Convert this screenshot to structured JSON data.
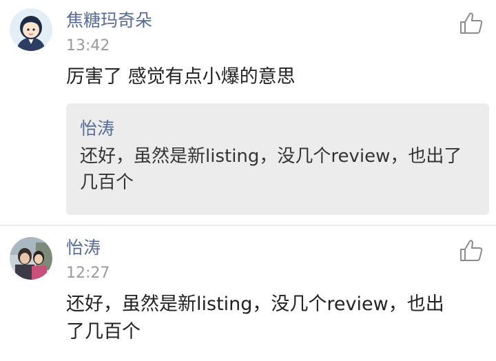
{
  "comments": [
    {
      "username": "焦糖玛奇朵",
      "time": "13:42",
      "text": "厉害了  感觉有点小爆的意思",
      "reply": {
        "author": "怡涛",
        "lines": [
          "还好，虽然是新listing，没几个review，也出了",
          "几百个"
        ]
      }
    },
    {
      "username": "怡涛",
      "time": "12:27",
      "lines": [
        "还好，虽然是新listing，没几个review，也出",
        "了几百个"
      ]
    }
  ],
  "icons": {
    "like": "thumbs-up-icon"
  },
  "colors": {
    "username": "#576b95",
    "timestamp": "#9a9a9a",
    "text": "#222222",
    "reply_background": "#ececec",
    "divider": "#ededed"
  }
}
